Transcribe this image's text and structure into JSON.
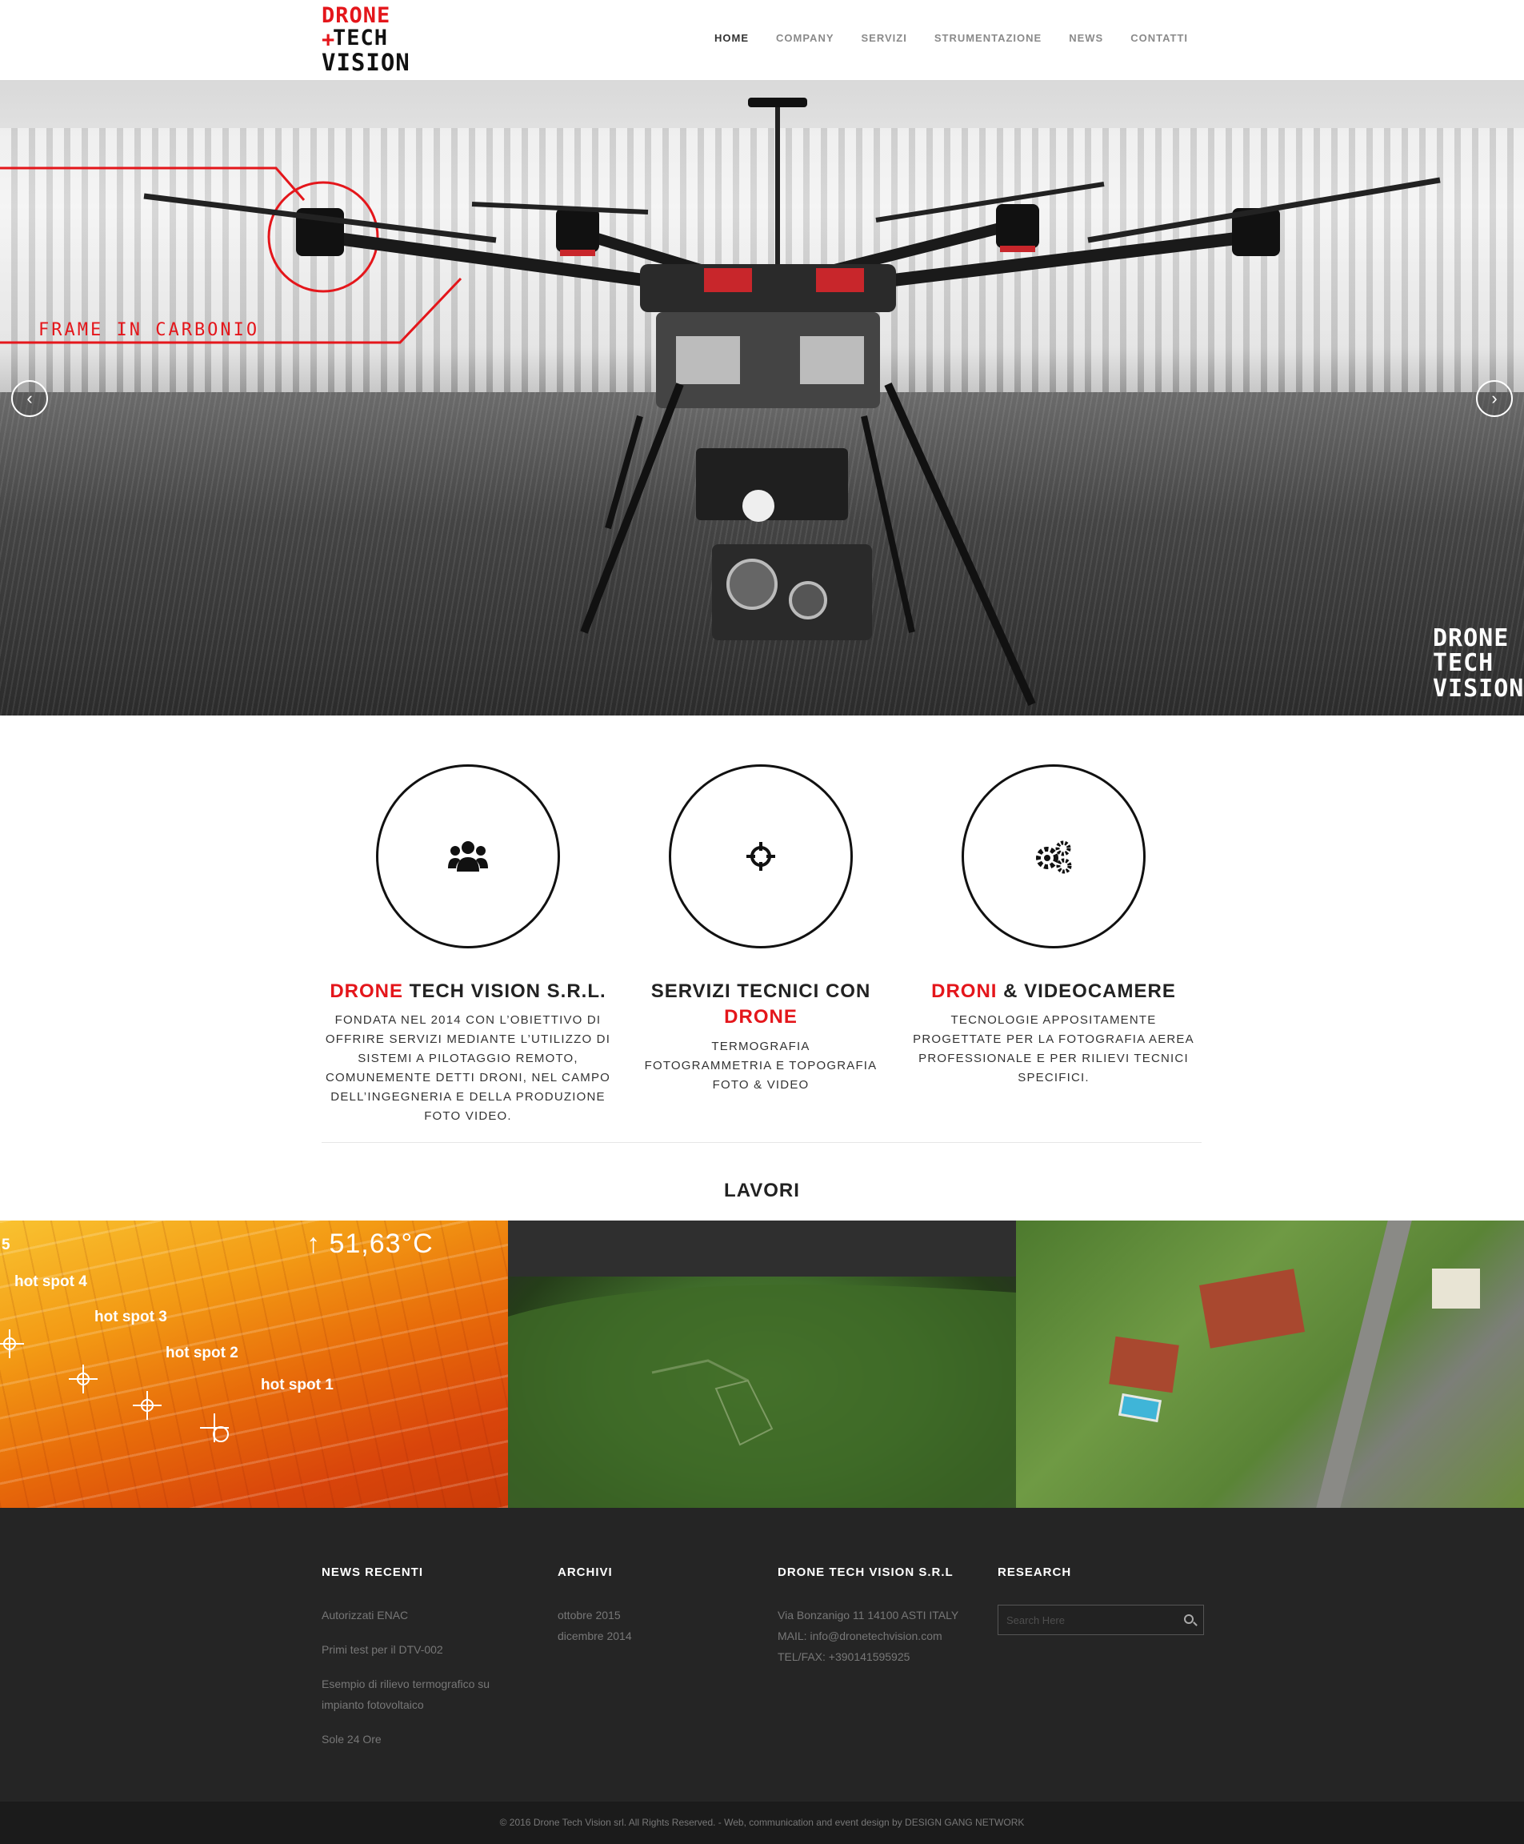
{
  "header": {
    "logo": {
      "line1": "DRONE",
      "line2": "TECH",
      "line3": "VISION"
    },
    "nav": [
      {
        "label": "HOME"
      },
      {
        "label": "COMPANY"
      },
      {
        "label": "SERVIZI"
      },
      {
        "label": "STRUMENTAZIONE"
      },
      {
        "label": "NEWS"
      },
      {
        "label": "CONTATTI"
      }
    ],
    "active_nav": "HOME"
  },
  "hero": {
    "label": "FRAME IN CARBONIO",
    "watermark": {
      "line1": "DRONE",
      "line2": "TECH",
      "line3": "VISION"
    },
    "prev_icon": "chevron-left-icon",
    "next_icon": "chevron-right-icon",
    "prev_glyph": "‹",
    "next_glyph": "›"
  },
  "features": [
    {
      "icon": "users-icon",
      "title_red": "DRONE",
      "title_rest": " TECH VISION S.R.L.",
      "text": "FONDATA NEL 2014 CON L’OBIETTIVO DI OFFRIRE SERVIZI MEDIANTE L’UTILIZZO DI SISTEMI A PILOTAGGIO REMOTO, COMUNEMENTE DETTI DRONI, NEL CAMPO DELL’INGEGNERIA E DELLA PRODUZIONE FOTO VIDEO."
    },
    {
      "icon": "crosshair-icon",
      "title_rest": "SERVIZI TECNICI CON",
      "title_red": "DRONE",
      "lines": [
        "TERMOGRAFIA",
        "FOTOGRAMMETRIA E TOPOGRAFIA",
        "FOTO & VIDEO"
      ]
    },
    {
      "icon": "gears-icon",
      "title_red": "DRONI",
      "title_rest": " & VIDEOCAMERE",
      "text": "TECNOLOGIE APPOSITAMENTE PROGETTATE PER LA FOTOGRAFIA AEREA PROFESSIONALE E PER RILIEVI TECNICI SPECIFICI."
    }
  ],
  "works": {
    "title": "LAVORI",
    "thermal": {
      "temperature": "↑ 51,63°C",
      "corner_digit": "5",
      "hotspots": [
        "hot spot 4",
        "hot spot 3",
        "hot spot 2",
        "hot spot 1"
      ]
    }
  },
  "footer": {
    "news": {
      "title": "NEWS RECENTI",
      "items": [
        "Autorizzati ENAC",
        "Primi test per il DTV-002",
        "Esempio di rilievo termografico su impianto fotovoltaico",
        "Sole 24 Ore"
      ]
    },
    "archive": {
      "title": "ARCHIVI",
      "items": [
        "ottobre 2015",
        "dicembre 2014"
      ]
    },
    "company": {
      "title": "DRONE TECH VISION S.R.L",
      "address": "Via Bonzanigo 11 14100 ASTI ITALY",
      "mail": "MAIL: info@dronetechvision.com",
      "phone": "TEL/FAX: +390141595925"
    },
    "research": {
      "title": "RESEARCH",
      "placeholder": "Search Here"
    }
  },
  "copyright": "© 2016 Drone Tech Vision srl. All Rights Reserved. - Web, communication and event design by DESIGN GANG NETWORK",
  "colors": {
    "accent": "#e4161b",
    "footer_bg": "#252525",
    "bottom_bar_bg": "#1b1b1b"
  }
}
